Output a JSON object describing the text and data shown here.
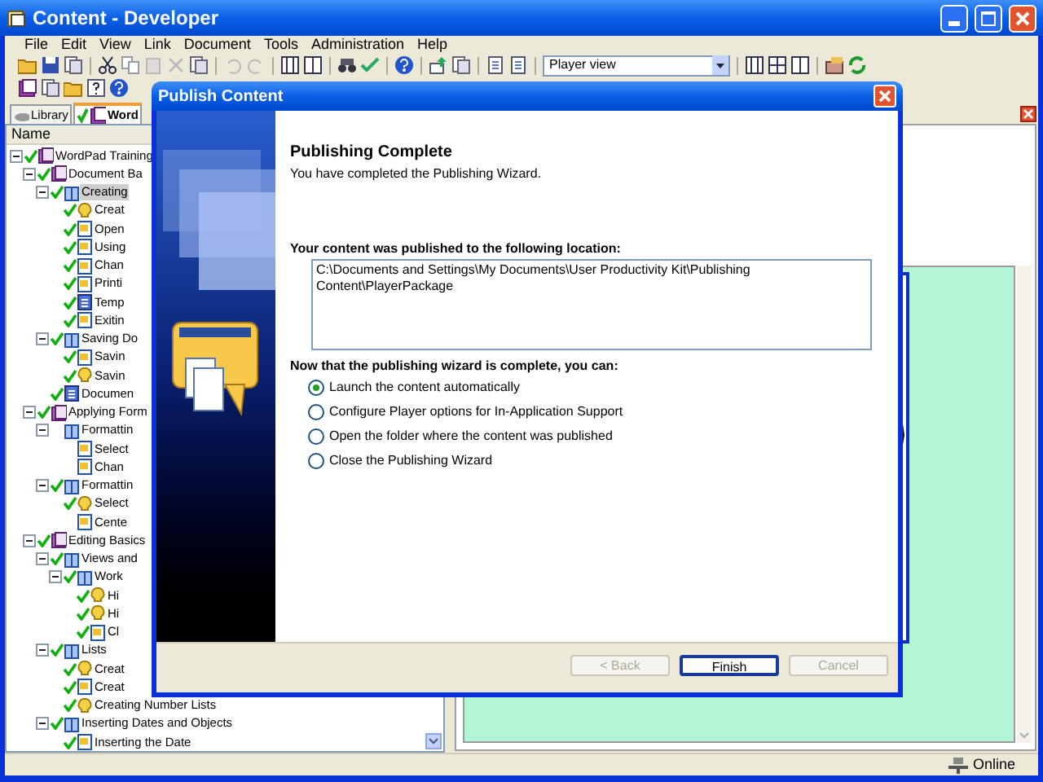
{
  "window": {
    "title": "Content - Developer"
  },
  "menu": [
    "File",
    "Edit",
    "View",
    "Link",
    "Document",
    "Tools",
    "Administration",
    "Help"
  ],
  "toolbar": {
    "view_select": "Player view"
  },
  "tabs": [
    {
      "label": "Library",
      "selected": false
    },
    {
      "label": "Word",
      "selected": true
    }
  ],
  "tree_header": "Name",
  "tree": [
    {
      "label": "WordPad Training",
      "kind": "module",
      "checked": true,
      "selected": false,
      "expanded": true,
      "children": [
        {
          "label": "Document Ba",
          "kind": "module",
          "checked": true,
          "selected": false,
          "expanded": true,
          "children": [
            {
              "label": "Creating",
              "kind": "section",
              "checked": true,
              "selected": true,
              "expanded": true,
              "children": [
                {
                  "label": "Creat",
                  "kind": "concept",
                  "checked": true,
                  "selected": false
                },
                {
                  "label": "Open",
                  "kind": "topic",
                  "checked": true,
                  "selected": false
                },
                {
                  "label": "Using",
                  "kind": "topic",
                  "checked": true,
                  "selected": false
                },
                {
                  "label": "Chan",
                  "kind": "topic",
                  "checked": true,
                  "selected": false
                },
                {
                  "label": "Printi",
                  "kind": "topic",
                  "checked": true,
                  "selected": false
                },
                {
                  "label": "Temp",
                  "kind": "document",
                  "checked": true,
                  "selected": false
                },
                {
                  "label": "Exitin",
                  "kind": "topic",
                  "checked": true,
                  "selected": false
                }
              ]
            },
            {
              "label": "Saving Do",
              "kind": "section",
              "checked": true,
              "selected": false,
              "expanded": true,
              "children": [
                {
                  "label": "Savin",
                  "kind": "topic",
                  "checked": true,
                  "selected": false
                },
                {
                  "label": "Savin",
                  "kind": "concept",
                  "checked": true,
                  "selected": false
                }
              ]
            },
            {
              "label": "Documen",
              "kind": "document",
              "checked": true,
              "selected": false
            }
          ]
        },
        {
          "label": "Applying Form",
          "kind": "module",
          "checked": true,
          "selected": false,
          "expanded": true,
          "children": [
            {
              "label": "Formattin",
              "kind": "section",
              "checked": false,
              "selected": false,
              "expanded": true,
              "children": [
                {
                  "label": "Select",
                  "kind": "topic",
                  "checked": false,
                  "selected": false
                },
                {
                  "label": "Chan",
                  "kind": "topic",
                  "checked": false,
                  "selected": false
                }
              ]
            },
            {
              "label": "Formattin",
              "kind": "section",
              "checked": true,
              "selected": false,
              "expanded": true,
              "children": [
                {
                  "label": "Select",
                  "kind": "concept",
                  "checked": true,
                  "selected": false
                },
                {
                  "label": "Cente",
                  "kind": "topic",
                  "checked": false,
                  "selected": false
                }
              ]
            }
          ]
        },
        {
          "label": "Editing Basics",
          "kind": "module",
          "checked": true,
          "selected": false,
          "expanded": true,
          "children": [
            {
              "label": "Views and",
              "kind": "section",
              "checked": true,
              "selected": false,
              "expanded": true,
              "children": [
                {
                  "label": "Work",
                  "kind": "section",
                  "checked": true,
                  "selected": false,
                  "expanded": true,
                  "children": [
                    {
                      "label": "Hi",
                      "kind": "concept",
                      "checked": true,
                      "selected": false
                    },
                    {
                      "label": "Hi",
                      "kind": "concept",
                      "checked": true,
                      "selected": false
                    },
                    {
                      "label": "Cl",
                      "kind": "topic",
                      "checked": true,
                      "selected": false
                    }
                  ]
                }
              ]
            },
            {
              "label": "Lists",
              "kind": "section",
              "checked": true,
              "selected": false,
              "expanded": true,
              "children": [
                {
                  "label": "Creat",
                  "kind": "concept",
                  "checked": true,
                  "selected": false
                },
                {
                  "label": "Creat",
                  "kind": "topic",
                  "checked": true,
                  "selected": false
                },
                {
                  "label": "Creating Number Lists",
                  "kind": "concept",
                  "checked": true,
                  "selected": false
                }
              ]
            },
            {
              "label": "Inserting Dates and Objects",
              "kind": "section",
              "checked": true,
              "selected": false,
              "expanded": true,
              "children": [
                {
                  "label": "Inserting the Date",
                  "kind": "topic",
                  "checked": true,
                  "selected": false
                }
              ]
            }
          ]
        }
      ]
    }
  ],
  "dialog": {
    "title": "Publish Content",
    "heading": "Publishing Complete",
    "subheading": "You have completed the Publishing Wizard.",
    "location_label": "Your content was published to the following location:",
    "location_path": "C:\\Documents and Settings\\My Documents\\User Productivity Kit\\Publishing Content\\PlayerPackage",
    "options_label": "Now that the publishing wizard is complete, you can:",
    "options": [
      {
        "label": "Launch the content automatically",
        "selected": true
      },
      {
        "label": "Configure Player options for In-Application Support",
        "selected": false
      },
      {
        "label": "Open the folder where the content was published",
        "selected": false
      },
      {
        "label": "Close the Publishing Wizard",
        "selected": false
      }
    ],
    "buttons": [
      {
        "label": "< Back",
        "disabled": true,
        "default": false
      },
      {
        "label": "Finish",
        "disabled": false,
        "default": true
      },
      {
        "label": "Cancel",
        "disabled": true,
        "default": false
      }
    ]
  },
  "status_bar": {
    "connection": "Online"
  }
}
